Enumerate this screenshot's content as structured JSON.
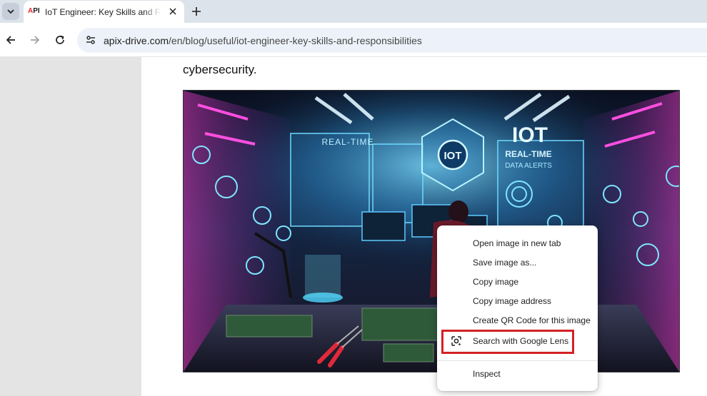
{
  "browser": {
    "tab": {
      "favicon_text_a": "A",
      "favicon_text_b": "PI",
      "title": "IoT Engineer: Key Skills and Responsibilities"
    },
    "url_host": "apix-drive.com",
    "url_path": "/en/blog/useful/iot-engineer-key-skills-and-responsibilities"
  },
  "page": {
    "paragraph_end": "cybersecurity.",
    "image": {
      "text_realtime": "REAL-TIME",
      "text_iot_hex": "IOT",
      "text_iot_big": "IOT",
      "text_realtime2": "REAL-TIME",
      "text_alerts": "DATA ALERTS",
      "accent_colors": [
        "#ff3fd4",
        "#4fd8ff",
        "#b35cff"
      ]
    }
  },
  "context_menu": {
    "items": [
      {
        "label": "Open image in new tab"
      },
      {
        "label": "Save image as..."
      },
      {
        "label": "Copy image"
      },
      {
        "label": "Copy image address"
      },
      {
        "label": "Create QR Code for this image"
      },
      {
        "label": "Search with Google Lens",
        "icon": "google-lens-icon",
        "highlighted": true
      },
      {
        "label": "Inspect"
      }
    ],
    "highlight_color": "#d42126"
  }
}
